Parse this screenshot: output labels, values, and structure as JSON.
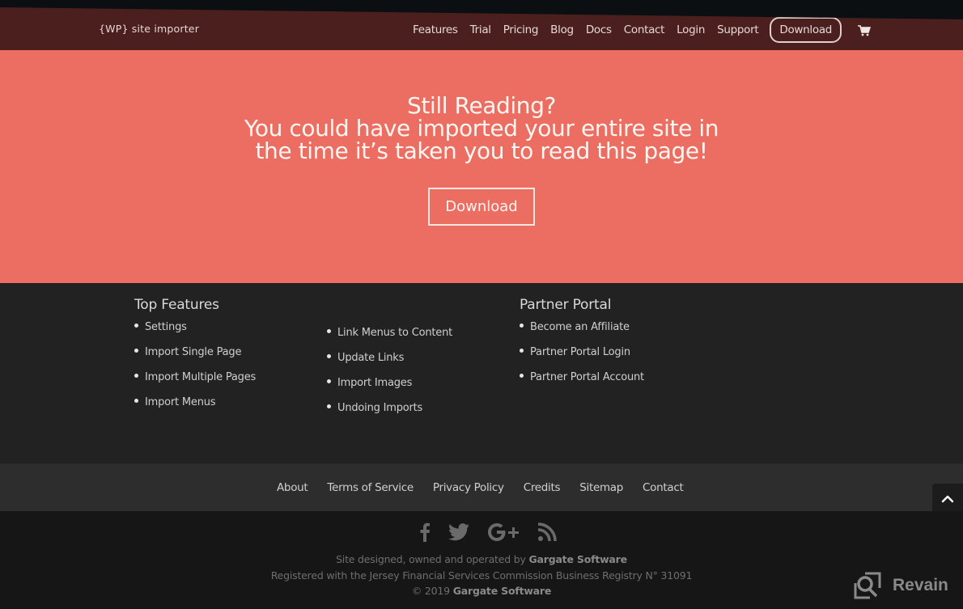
{
  "header": {
    "logo": "{WP} site importer",
    "nav": [
      "Features",
      "Trial",
      "Pricing",
      "Blog",
      "Docs",
      "Contact",
      "Login",
      "Support"
    ],
    "download_label": "Download",
    "cart_icon": "shopping-cart-icon"
  },
  "hero": {
    "line1": "Still Reading?",
    "line2": "You could have imported your entire site in",
    "line3": "the time it’s taken you to read this page!",
    "button_label": "Download"
  },
  "features": {
    "col1": {
      "heading": "Top Features",
      "items": [
        "Settings",
        "Import Single Page",
        "Import Multiple Pages",
        "Import Menus"
      ]
    },
    "col2": {
      "items": [
        "Link Menus to Content",
        "Update Links",
        "Import Images",
        "Undoing Imports"
      ]
    },
    "col3": {
      "heading": "Partner Portal",
      "items": [
        "Become an Affiliate",
        "Partner Portal Login",
        "Partner Portal Account"
      ]
    }
  },
  "bottom_nav": [
    "About",
    "Terms of Service",
    "Privacy Policy",
    "Credits",
    "Sitemap",
    "Contact"
  ],
  "social": [
    "facebook-icon",
    "twitter-icon",
    "google-plus-icon",
    "rss-icon"
  ],
  "footer": {
    "line1_prefix": "Site designed, owned and operated by ",
    "line1_company": "Gargate Software",
    "line2": "Registered with the Jersey Financial Services Commission Business Registry N° 31091",
    "line3_prefix": "© 2019 ",
    "line3_company": "Gargate Software"
  },
  "watermark": "Revain",
  "colors": {
    "header_bg": "#4a1f1e",
    "hero_bg": "#ec6d61",
    "features_bg": "#222222",
    "bottomnav_bg": "#2d2d2d",
    "footer_bg": "#161616"
  }
}
